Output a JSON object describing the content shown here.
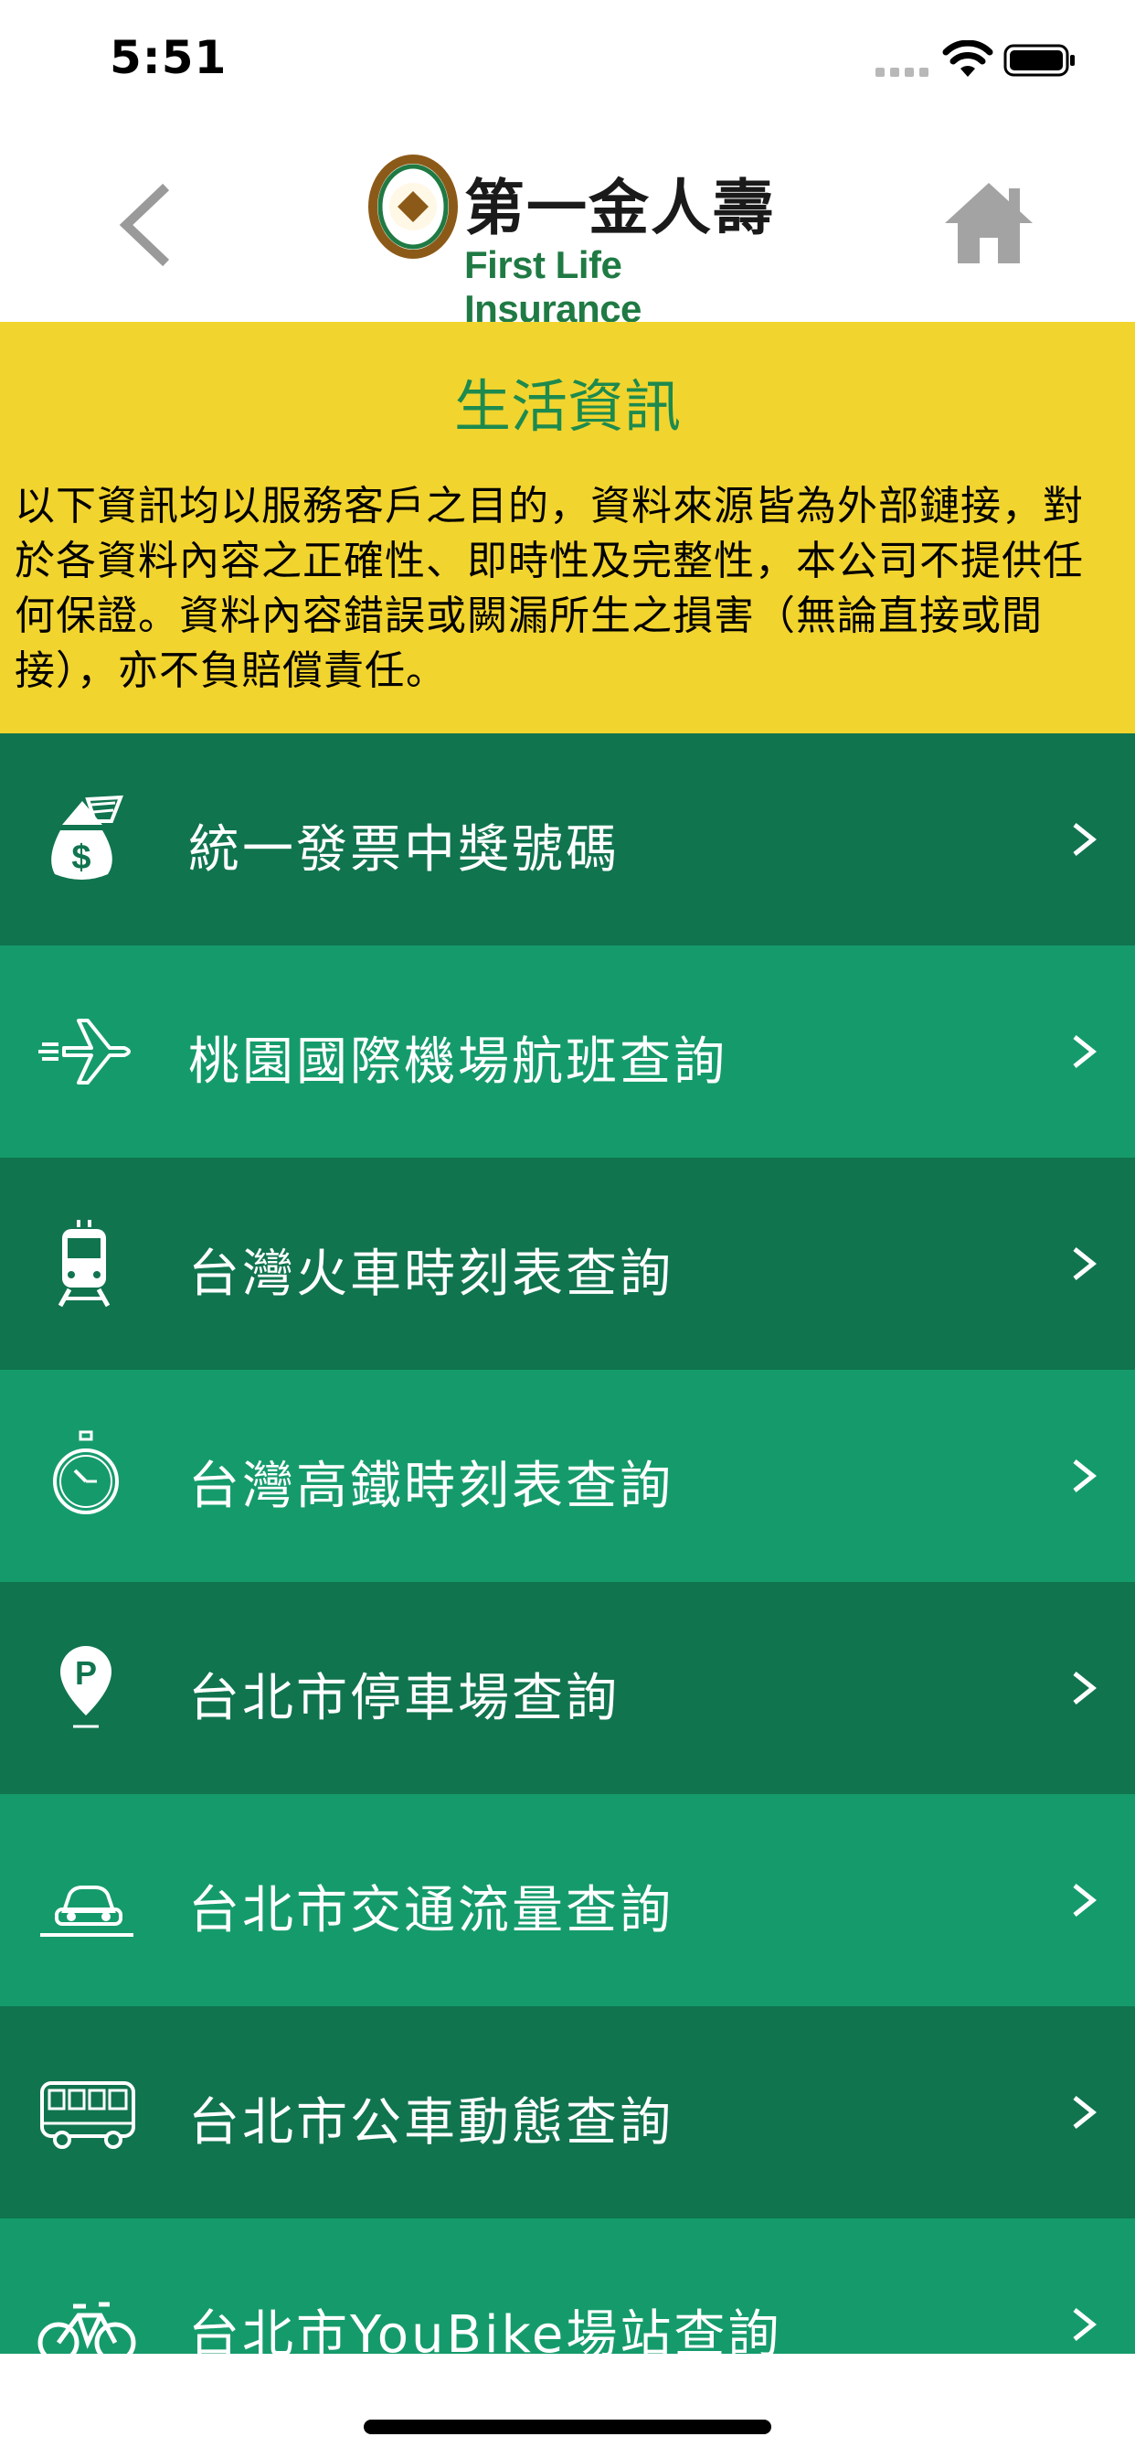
{
  "status_bar": {
    "time": "5:51"
  },
  "nav": {
    "back_icon": "chevron-left-icon",
    "home_icon": "home-icon",
    "logo": {
      "name_zh": "第一金人壽",
      "name_en": "First Life Insurance"
    }
  },
  "banner": {
    "title": "生活資訊",
    "disclaimer": "以下資訊均以服務客戶之目的，資料來源皆為外部鏈接，對於各資料內容之正確性、即時性及完整性，本公司不提供任何保證。資料內容錯誤或闕漏所生之損害（無論直接或間接），亦不負賠償責任。"
  },
  "menu": {
    "items": [
      {
        "label": "統一發票中獎號碼",
        "icon": "money-bag-icon"
      },
      {
        "label": "桃園國際機場航班查詢",
        "icon": "airplane-icon"
      },
      {
        "label": "台灣火車時刻表查詢",
        "icon": "train-icon"
      },
      {
        "label": "台灣高鐵時刻表查詢",
        "icon": "stopwatch-icon"
      },
      {
        "label": "台北市停車場查詢",
        "icon": "parking-pin-icon"
      },
      {
        "label": "台北市交通流量查詢",
        "icon": "car-icon"
      },
      {
        "label": "台北市公車動態查詢",
        "icon": "bus-icon"
      },
      {
        "label": "台北市YouBike場站查詢",
        "icon": "bicycle-icon"
      }
    ],
    "chevron": ">"
  },
  "colors": {
    "banner_bg": "#f2d42e",
    "banner_title": "#1d8a4e",
    "row_dark": "#10744f",
    "row_light": "#159b6b"
  }
}
